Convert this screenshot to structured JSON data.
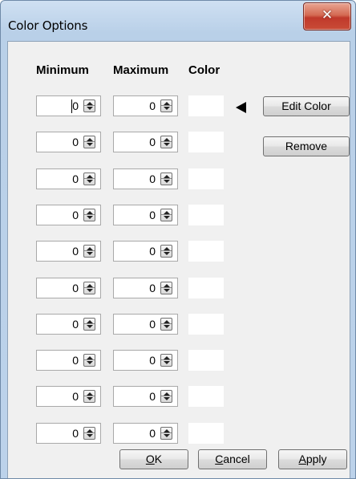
{
  "window": {
    "title": "Color Options",
    "close_icon": "close-x-icon"
  },
  "table": {
    "headers": {
      "minimum": "Minimum",
      "maximum": "Maximum",
      "color": "Color"
    },
    "rows": [
      {
        "min": "0",
        "max": "0",
        "color": "#ffffff"
      },
      {
        "min": "0",
        "max": "0",
        "color": "#ffffff"
      },
      {
        "min": "0",
        "max": "0",
        "color": "#ffffff"
      },
      {
        "min": "0",
        "max": "0",
        "color": "#ffffff"
      },
      {
        "min": "0",
        "max": "0",
        "color": "#ffffff"
      },
      {
        "min": "0",
        "max": "0",
        "color": "#ffffff"
      },
      {
        "min": "0",
        "max": "0",
        "color": "#ffffff"
      },
      {
        "min": "0",
        "max": "0",
        "color": "#ffffff"
      },
      {
        "min": "0",
        "max": "0",
        "color": "#ffffff"
      },
      {
        "min": "0",
        "max": "0",
        "color": "#ffffff"
      }
    ],
    "selected_row": 1
  },
  "buttons": {
    "edit_color": "Edit Color",
    "remove": "Remove",
    "ok": "OK",
    "cancel": "Cancel",
    "apply": "Apply"
  },
  "colors": {
    "title_gradient": "#bcd2ea",
    "close_red": "#c94b37",
    "dialog_bg": "#f0f0f0"
  }
}
